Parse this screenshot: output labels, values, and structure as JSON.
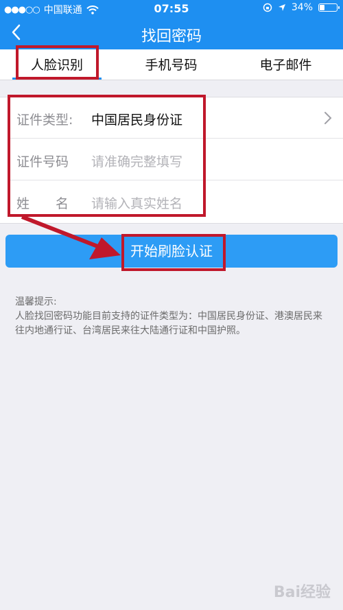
{
  "status_bar": {
    "carrier": "中国联通",
    "time": "07:55",
    "battery": "34%",
    "battery_level": 0.34
  },
  "nav": {
    "title": "找回密码"
  },
  "tabs": [
    {
      "label": "人脸识别",
      "active": true
    },
    {
      "label": "手机号码",
      "active": false
    },
    {
      "label": "电子邮件",
      "active": false
    }
  ],
  "form": {
    "id_type": {
      "label": "证件类型:",
      "value": "中国居民身份证"
    },
    "id_number": {
      "label": "证件号码",
      "placeholder": "请准确完整填写"
    },
    "name": {
      "label": "姓　　名",
      "placeholder": "请输入真实姓名"
    }
  },
  "actions": {
    "start_label": "开始刷脸认证"
  },
  "tips": {
    "title": "温馨提示:",
    "body": "人脸找回密码功能目前支持的证件类型为：中国居民身份证、港澳居民来往内地通行证、台湾居民来往大陆通行证和中国护照。"
  },
  "watermark": {
    "text": "Bai经验"
  },
  "colors": {
    "primary": "#1e8ff1",
    "button": "#2d9cf5",
    "annotation": "#c0182b",
    "background": "#efeff4"
  },
  "icons": [
    "back-chevron-icon",
    "wifi-icon",
    "lock-rotation-icon",
    "location-arrow-icon",
    "battery-icon",
    "chevron-right-icon"
  ]
}
